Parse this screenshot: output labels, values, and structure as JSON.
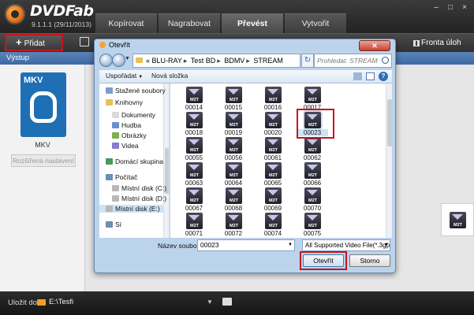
{
  "app": {
    "brand": "DVDFab",
    "version": "9.1.1.1 (29/11/2013)",
    "tabs": [
      "Kopírovat",
      "Nagrabovat",
      "Převést",
      "Vytvořit"
    ],
    "active_tab": "Převést"
  },
  "toolbar": {
    "add_label": "Přidat",
    "queue_label": "Fronta úloh"
  },
  "section": {
    "label": "Výstup"
  },
  "profile": {
    "tile_label": "MKV",
    "name": "MKV",
    "advanced_button": "Rozšířená nastavení"
  },
  "bottom": {
    "save_label": "Uložit do:",
    "path": "E:\\Tesfi"
  },
  "dialog": {
    "title": "Otevřít",
    "breadcrumb": [
      "BLU-RAY",
      "Test BD",
      "BDMV",
      "STREAM"
    ],
    "breadcrumb_prefix": "«",
    "search_placeholder": "Prohledat: STREAM",
    "commands": {
      "organize": "Uspořádat",
      "new_folder": "Nová složka"
    },
    "nav": [
      {
        "label": "Stažené soubory",
        "icon": "downloads-icon"
      },
      {
        "label": "Knihovny",
        "icon": "libraries-icon"
      },
      {
        "label": "Dokumenty",
        "icon": "documents-icon"
      },
      {
        "label": "Hudba",
        "icon": "music-icon"
      },
      {
        "label": "Obrázky",
        "icon": "pictures-icon"
      },
      {
        "label": "Videa",
        "icon": "videos-icon"
      },
      {
        "label": "Domácí skupina",
        "icon": "homegroup-icon"
      },
      {
        "label": "Počítač",
        "icon": "computer-icon"
      },
      {
        "label": "Místní disk (C:)",
        "icon": "drive-icon"
      },
      {
        "label": "Místní disk (D:)",
        "icon": "drive-icon"
      },
      {
        "label": "Místní disk (E:)",
        "icon": "drive-icon"
      },
      {
        "label": "Sí",
        "icon": "network-icon"
      }
    ],
    "icon_badge": "M2T",
    "files": [
      "00014",
      "00015",
      "00016",
      "00017",
      "00018",
      "00019",
      "00020",
      "00023",
      "00055",
      "00056",
      "00061",
      "00062",
      "00063",
      "00064",
      "00065",
      "00066",
      "00067",
      "00068",
      "00069",
      "00070",
      "00071",
      "00072",
      "00074",
      "00075"
    ],
    "selected_file": "00023",
    "filename_label": "Název souboru:",
    "filename_value": "00023",
    "filetype_value": "All Supported Video File(*.3gp *",
    "open_button": "Otevřít",
    "cancel_button": "Storno"
  },
  "colors": {
    "highlight": "#c4161c",
    "section_bar": "#3e6aa3",
    "selection": "#cfe3f7"
  }
}
